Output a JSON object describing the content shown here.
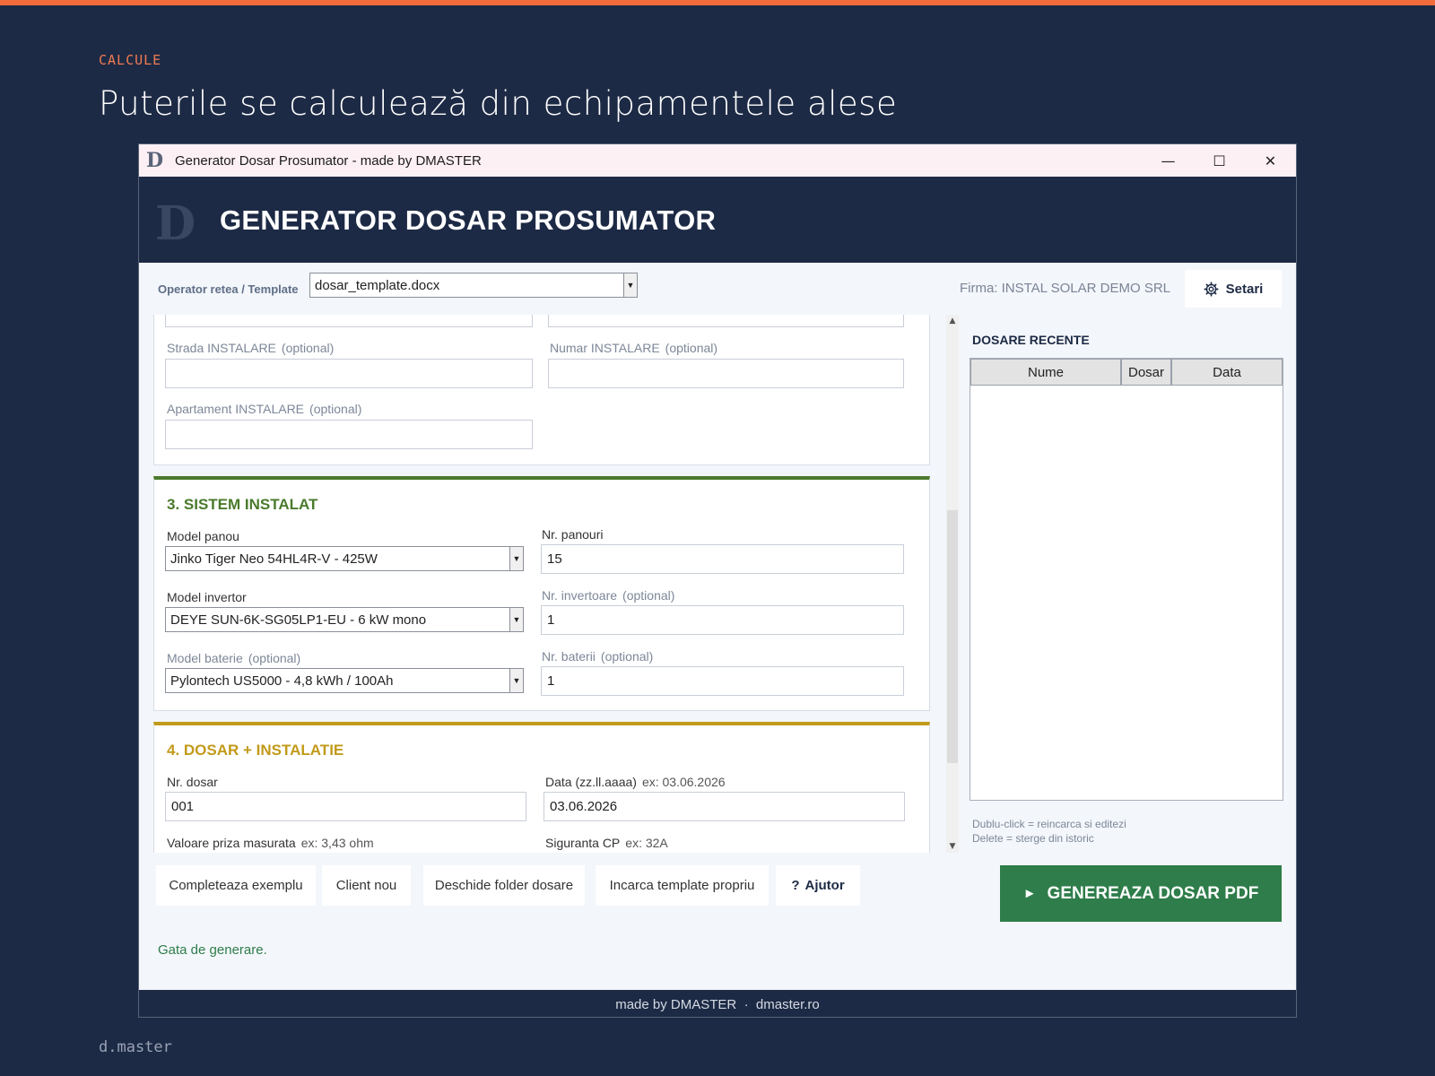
{
  "slide": {
    "kicker": "CALCULE",
    "title": "Puterile se calculează din echipamentele alese",
    "footer": "d.master",
    "accent": "#f26b3a",
    "background": "#1d2a45"
  },
  "window": {
    "title": "Generator Dosar Prosumator - made by DMASTER",
    "logo": "D",
    "minimize": "—",
    "maximize": "☐",
    "close": "✕"
  },
  "header": {
    "logo": "D",
    "title": "GENERATOR DOSAR PROSUMATOR"
  },
  "toolbar": {
    "template_label": "Operator retea / Template",
    "template_value": "dosar_template.docx",
    "firma": "Firma: INSTAL SOLAR DEMO SRL",
    "settings_label": "Setari"
  },
  "section2": {
    "street_label": "Strada INSTALARE",
    "street_hint": "(optional)",
    "street_value": "",
    "number_label": "Numar INSTALARE",
    "number_hint": "(optional)",
    "number_value": "",
    "apartment_label": "Apartament INSTALARE",
    "apartment_hint": "(optional)",
    "apartment_value": ""
  },
  "section3": {
    "title": "3. SISTEM INSTALAT",
    "color": "#4a7a2c",
    "panel_model_label": "Model panou",
    "panel_model_value": "Jinko Tiger Neo 54HL4R-V - 425W",
    "panel_count_label": "Nr. panouri",
    "panel_count_value": "15",
    "inverter_model_label": "Model invertor",
    "inverter_model_value": "DEYE SUN-6K-SG05LP1-EU - 6 kW mono",
    "inverter_count_label": "Nr. invertoare",
    "inverter_count_hint": "(optional)",
    "inverter_count_value": "1",
    "battery_model_label": "Model baterie",
    "battery_model_hint": "(optional)",
    "battery_model_value": "Pylontech US5000 - 4,8 kWh / 100Ah",
    "battery_count_label": "Nr. baterii",
    "battery_count_hint": "(optional)",
    "battery_count_value": "1"
  },
  "section4": {
    "title": "4. DOSAR + INSTALATIE",
    "color": "#c29a1a",
    "file_no_label": "Nr. dosar",
    "file_no_value": "001",
    "date_label": "Data (zz.ll.aaaa)",
    "date_hint": "ex: 03.06.2026",
    "date_value": "03.06.2026",
    "resistance_label": "Valoare priza masurata",
    "resistance_hint": "ex: 3,43 ohm",
    "fuse_label": "Siguranta CP",
    "fuse_hint": "ex: 32A"
  },
  "recent": {
    "title": "DOSARE RECENTE",
    "columns": [
      "Nume",
      "Dosar",
      "Data"
    ],
    "rows": [],
    "help_line1": "Dublu-click = reincarca si editezi",
    "help_line2": "Delete = sterge din istoric"
  },
  "actions": {
    "fill_example": "Completeaza exemplu",
    "new_client": "Client nou",
    "open_folder": "Deschide folder dosare",
    "load_template": "Incarca template propriu",
    "help_icon": "?",
    "help": "Ajutor",
    "generate_icon": "►",
    "generate": "GENEREAZA DOSAR PDF",
    "generate_color": "#2e7d4a",
    "status": "Gata de generare."
  },
  "footer": {
    "text": "made by DMASTER  ·  dmaster.ro"
  }
}
